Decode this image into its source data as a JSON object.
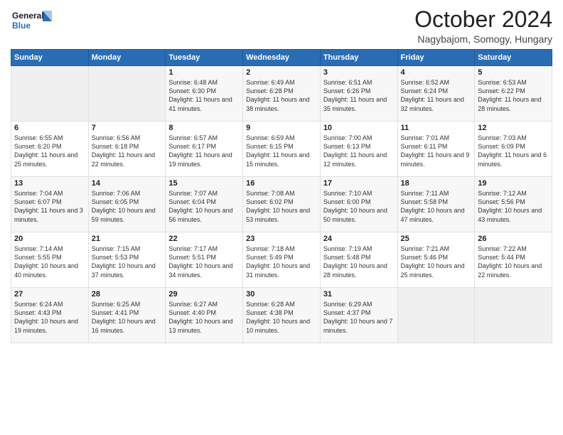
{
  "logo": {
    "line1": "General",
    "line2": "Blue"
  },
  "title": "October 2024",
  "location": "Nagybajom, Somogy, Hungary",
  "days_of_week": [
    "Sunday",
    "Monday",
    "Tuesday",
    "Wednesday",
    "Thursday",
    "Friday",
    "Saturday"
  ],
  "weeks": [
    [
      {
        "day": "",
        "empty": true
      },
      {
        "day": "",
        "empty": true
      },
      {
        "day": "1",
        "sunrise": "6:48 AM",
        "sunset": "6:30 PM",
        "daylight": "11 hours and 41 minutes."
      },
      {
        "day": "2",
        "sunrise": "6:49 AM",
        "sunset": "6:28 PM",
        "daylight": "11 hours and 38 minutes."
      },
      {
        "day": "3",
        "sunrise": "6:51 AM",
        "sunset": "6:26 PM",
        "daylight": "11 hours and 35 minutes."
      },
      {
        "day": "4",
        "sunrise": "6:52 AM",
        "sunset": "6:24 PM",
        "daylight": "11 hours and 32 minutes."
      },
      {
        "day": "5",
        "sunrise": "6:53 AM",
        "sunset": "6:22 PM",
        "daylight": "11 hours and 28 minutes."
      }
    ],
    [
      {
        "day": "6",
        "sunrise": "6:55 AM",
        "sunset": "6:20 PM",
        "daylight": "11 hours and 25 minutes."
      },
      {
        "day": "7",
        "sunrise": "6:56 AM",
        "sunset": "6:18 PM",
        "daylight": "11 hours and 22 minutes."
      },
      {
        "day": "8",
        "sunrise": "6:57 AM",
        "sunset": "6:17 PM",
        "daylight": "11 hours and 19 minutes."
      },
      {
        "day": "9",
        "sunrise": "6:59 AM",
        "sunset": "6:15 PM",
        "daylight": "11 hours and 15 minutes."
      },
      {
        "day": "10",
        "sunrise": "7:00 AM",
        "sunset": "6:13 PM",
        "daylight": "11 hours and 12 minutes."
      },
      {
        "day": "11",
        "sunrise": "7:01 AM",
        "sunset": "6:11 PM",
        "daylight": "11 hours and 9 minutes."
      },
      {
        "day": "12",
        "sunrise": "7:03 AM",
        "sunset": "6:09 PM",
        "daylight": "11 hours and 6 minutes."
      }
    ],
    [
      {
        "day": "13",
        "sunrise": "7:04 AM",
        "sunset": "6:07 PM",
        "daylight": "11 hours and 3 minutes."
      },
      {
        "day": "14",
        "sunrise": "7:06 AM",
        "sunset": "6:05 PM",
        "daylight": "10 hours and 59 minutes."
      },
      {
        "day": "15",
        "sunrise": "7:07 AM",
        "sunset": "6:04 PM",
        "daylight": "10 hours and 56 minutes."
      },
      {
        "day": "16",
        "sunrise": "7:08 AM",
        "sunset": "6:02 PM",
        "daylight": "10 hours and 53 minutes."
      },
      {
        "day": "17",
        "sunrise": "7:10 AM",
        "sunset": "6:00 PM",
        "daylight": "10 hours and 50 minutes."
      },
      {
        "day": "18",
        "sunrise": "7:11 AM",
        "sunset": "5:58 PM",
        "daylight": "10 hours and 47 minutes."
      },
      {
        "day": "19",
        "sunrise": "7:12 AM",
        "sunset": "5:56 PM",
        "daylight": "10 hours and 43 minutes."
      }
    ],
    [
      {
        "day": "20",
        "sunrise": "7:14 AM",
        "sunset": "5:55 PM",
        "daylight": "10 hours and 40 minutes."
      },
      {
        "day": "21",
        "sunrise": "7:15 AM",
        "sunset": "5:53 PM",
        "daylight": "10 hours and 37 minutes."
      },
      {
        "day": "22",
        "sunrise": "7:17 AM",
        "sunset": "5:51 PM",
        "daylight": "10 hours and 34 minutes."
      },
      {
        "day": "23",
        "sunrise": "7:18 AM",
        "sunset": "5:49 PM",
        "daylight": "10 hours and 31 minutes."
      },
      {
        "day": "24",
        "sunrise": "7:19 AM",
        "sunset": "5:48 PM",
        "daylight": "10 hours and 28 minutes."
      },
      {
        "day": "25",
        "sunrise": "7:21 AM",
        "sunset": "5:46 PM",
        "daylight": "10 hours and 25 minutes."
      },
      {
        "day": "26",
        "sunrise": "7:22 AM",
        "sunset": "5:44 PM",
        "daylight": "10 hours and 22 minutes."
      }
    ],
    [
      {
        "day": "27",
        "sunrise": "6:24 AM",
        "sunset": "4:43 PM",
        "daylight": "10 hours and 19 minutes."
      },
      {
        "day": "28",
        "sunrise": "6:25 AM",
        "sunset": "4:41 PM",
        "daylight": "10 hours and 16 minutes."
      },
      {
        "day": "29",
        "sunrise": "6:27 AM",
        "sunset": "4:40 PM",
        "daylight": "10 hours and 13 minutes."
      },
      {
        "day": "30",
        "sunrise": "6:28 AM",
        "sunset": "4:38 PM",
        "daylight": "10 hours and 10 minutes."
      },
      {
        "day": "31",
        "sunrise": "6:29 AM",
        "sunset": "4:37 PM",
        "daylight": "10 hours and 7 minutes."
      },
      {
        "day": "",
        "empty": true
      },
      {
        "day": "",
        "empty": true
      }
    ]
  ]
}
